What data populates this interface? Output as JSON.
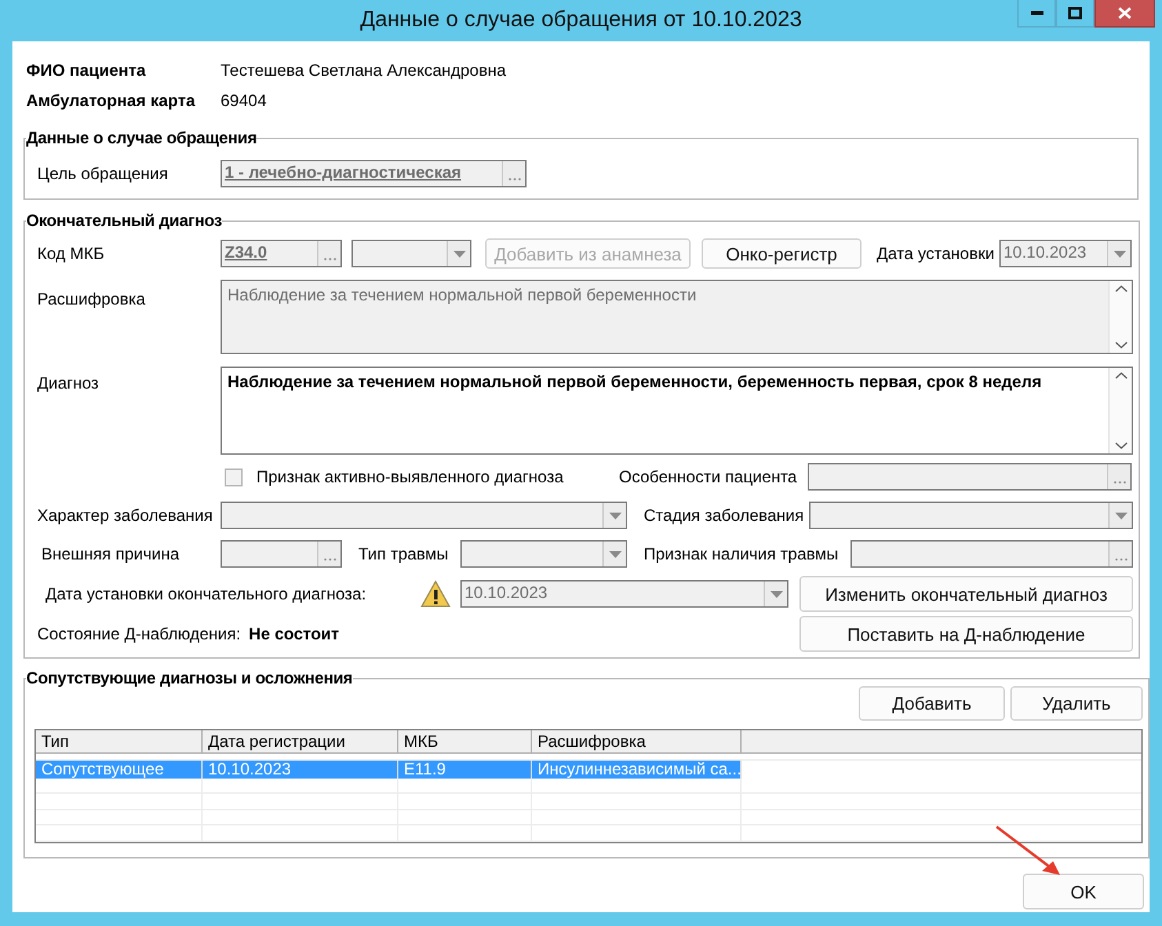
{
  "window": {
    "title": "Данные о случае обращения от 10.10.2023"
  },
  "patient": [
    {
      "label": "ФИО пациента",
      "value": "Тестешева Светлана Александровна"
    },
    {
      "label": "Амбулаторная карта",
      "value": "69404"
    }
  ],
  "visit": {
    "legend": "Данные о случае обращения",
    "purpose_label": "Цель обращения",
    "purpose_value": "1 - лечебно-диагностическая"
  },
  "final_diagnosis": {
    "legend": "Окончательный диагноз",
    "icd_label": "Код МКБ",
    "icd_value": "Z34.0",
    "add_from_history": {
      "label": "Добавить из анамнеза",
      "disabled": true
    },
    "onco_button": {
      "label": "Онко-регистр",
      "disabled": false
    },
    "date_label": "Дата установки",
    "date_value": "10.10.2023",
    "decoding_label": "Расшифровка",
    "decoding_value": "Наблюдение за течением нормальной первой беременности",
    "diagnosis_label": "Диагноз",
    "diagnosis_value": "Наблюдение за течением нормальной первой беременности, беременность первая, срок 8 неделя",
    "active_flag": {
      "label": "Признак активно-выявленного диагноза",
      "checked": false
    },
    "features_label": "Особенности пациента",
    "character_label": "Характер заболевания",
    "stage_label": "Стадия заболевания",
    "external_cause_label": "Внешняя причина",
    "injury_type_label": "Тип травмы",
    "injury_sign_label": "Признак наличия травмы",
    "final_date_label": "Дата установки окончательного диагноза:",
    "final_date_value": "10.10.2023",
    "change_button": "Изменить окончательный диагноз",
    "d_state_label": "Состояние Д-наблюдения:",
    "d_state_value": "Не состоит",
    "d_button": "Поставить на Д-наблюдение"
  },
  "companion": {
    "legend": "Сопутствующие диагнозы и осложнения",
    "buttons": [
      "Добавить",
      "Удалить"
    ],
    "columns": [
      "Тип",
      "Дата регистрации",
      "МКБ",
      "Расшифровка"
    ],
    "rows": [
      {
        "cells": [
          "Сопутствующее",
          "10.10.2023",
          "E11.9",
          "Инсулиннезависимый са..."
        ],
        "selected": true
      }
    ]
  },
  "ok_button": "OK"
}
